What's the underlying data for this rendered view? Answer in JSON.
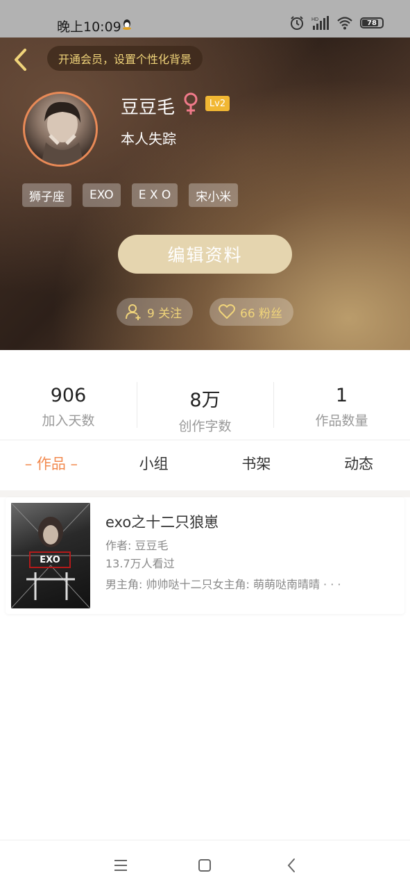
{
  "status_bar": {
    "time": "晚上10:09",
    "battery": "78",
    "battery_fraction": 0.78
  },
  "header": {
    "vip_prompt": "开通会员，设置个性化背景",
    "nickname": "豆豆毛",
    "level": "Lv2",
    "signature": "本人失踪",
    "tags": [
      "狮子座",
      "EXO",
      "E X O",
      "宋小米"
    ],
    "edit_button": "编辑资料",
    "following": "9 关注",
    "fans": "66 粉丝"
  },
  "stats": [
    {
      "value": "906",
      "label": "加入天数"
    },
    {
      "value": "8万",
      "label": "创作字数"
    },
    {
      "value": "1",
      "label": "作品数量"
    }
  ],
  "tabs": [
    "– 作品 –",
    "小组",
    "书架",
    "动态"
  ],
  "work": {
    "title": "exo之十二只狼崽",
    "author": "作者: 豆豆毛",
    "views": "13.7万人看过",
    "description": "男主角: 帅帅哒十二只女主角: 萌萌哒南晴晴 · · ·",
    "cover_label": "EXO"
  },
  "colors": {
    "accent": "#f2894e",
    "gold": "#f0d47a",
    "level_badge": "#f1b733",
    "edit_button": "#e5d5af"
  }
}
